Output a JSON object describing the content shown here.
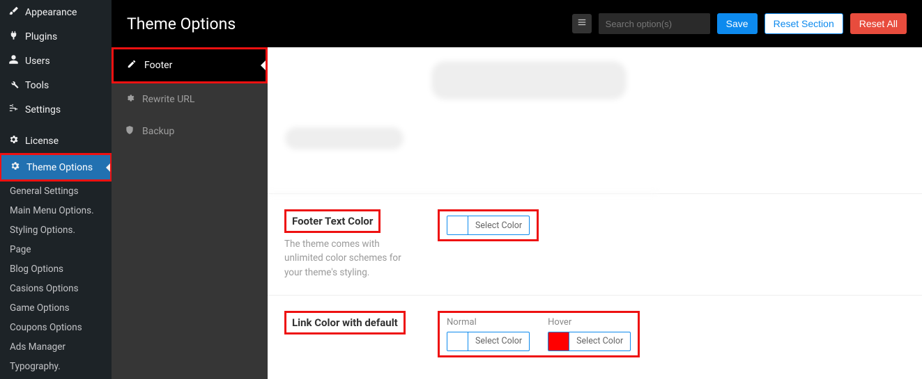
{
  "wp_sidebar": {
    "items": [
      {
        "icon": "brush",
        "label": "Appearance"
      },
      {
        "icon": "plug",
        "label": "Plugins"
      },
      {
        "icon": "user",
        "label": "Users"
      },
      {
        "icon": "wrench",
        "label": "Tools"
      },
      {
        "icon": "sliders",
        "label": "Settings"
      }
    ],
    "license": {
      "icon": "gear",
      "label": "License"
    },
    "theme_options": {
      "icon": "gear",
      "label": "Theme Options"
    },
    "subitems": [
      "General Settings",
      "Main Menu Options.",
      "Styling Options.",
      "Page",
      "Blog Options",
      "Casions Options",
      "Game Options",
      "Coupons Options",
      "Ads Manager",
      "Typography."
    ]
  },
  "to_tabs": [
    {
      "icon": "edit",
      "label": "Footer",
      "active": true
    },
    {
      "icon": "cogs",
      "label": "Rewrite URL"
    },
    {
      "icon": "shield",
      "label": "Backup"
    }
  ],
  "header": {
    "title": "Theme Options",
    "search_placeholder": "Search option(s)",
    "save": "Save",
    "reset_section": "Reset Section",
    "reset_all": "Reset All"
  },
  "options": {
    "footer_text_color": {
      "title": "Footer Text Color",
      "desc": "The theme comes with unlimited color schemes for your theme's styling.",
      "select_label": "Select Color",
      "swatch": "white"
    },
    "link_color": {
      "title": "Link Color with default",
      "normal_label": "Normal",
      "hover_label": "Hover",
      "select_label": "Select Color",
      "normal_swatch": "white",
      "hover_swatch": "red"
    }
  }
}
